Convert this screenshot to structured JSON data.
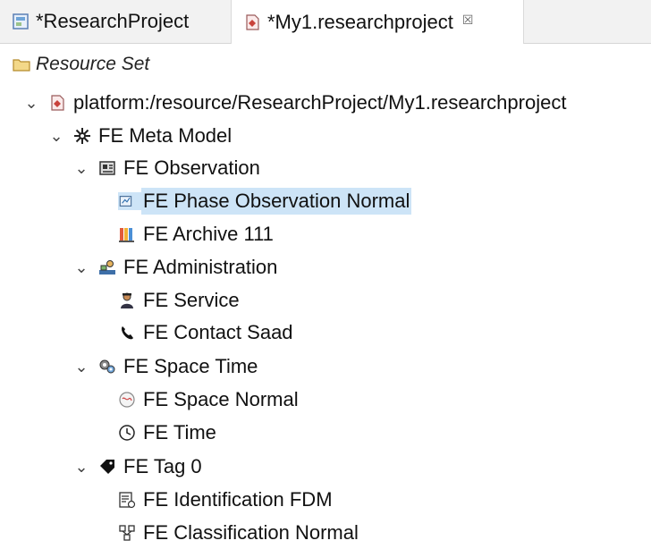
{
  "tabs": [
    {
      "label": "*ResearchProject",
      "icon": "diagram-editor-icon"
    },
    {
      "label": "*My1.researchproject",
      "icon": "model-file-icon",
      "close": "☒"
    }
  ],
  "resource_set": {
    "label": "Resource Set",
    "icon": "resource-set-folder-icon"
  },
  "tree": {
    "root": "platform:/resource/ResearchProject/My1.researchproject",
    "meta_model": "FE Meta Model",
    "observation": "FE Observation",
    "phase_observation": "FE Phase Observation Normal",
    "archive": "FE Archive 111",
    "administration": "FE Administration",
    "service": "FE Service",
    "contact": "FE Contact Saad",
    "space_time": "FE Space Time",
    "space_normal": "FE Space Normal",
    "time": "FE Time",
    "tag": "FE Tag 0",
    "identification": "FE Identification FDM",
    "classification": "FE Classification Normal"
  },
  "colors": {
    "selection": "#cde4f7",
    "tabbar": "#f2f2f2"
  }
}
